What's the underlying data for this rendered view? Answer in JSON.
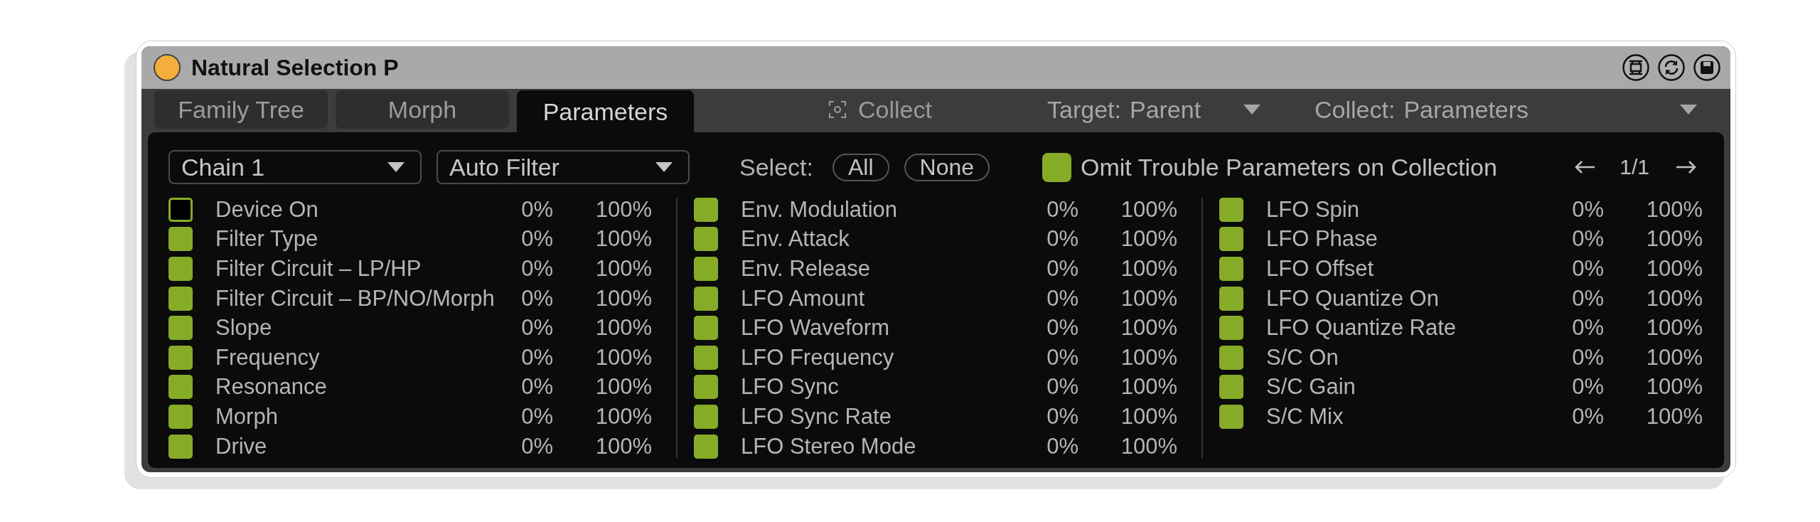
{
  "window": {
    "title": "Natural Selection P",
    "on": true
  },
  "tabs": [
    {
      "label": "Family Tree",
      "selected": false
    },
    {
      "label": "Morph",
      "selected": false
    },
    {
      "label": "Parameters",
      "selected": true
    }
  ],
  "collect_button": {
    "label": "Collect"
  },
  "target_menu": {
    "label": "Target:",
    "value": "Parent"
  },
  "collect_menu": {
    "label": "Collect:",
    "value": "Parameters"
  },
  "chain_menu": {
    "value": "Chain 1"
  },
  "device_menu": {
    "value": "Auto Filter"
  },
  "select": {
    "label": "Select:",
    "buttons": [
      "All",
      "None"
    ]
  },
  "omit_trouble": {
    "label": "Omit Trouble Parameters on Collection",
    "checked": true
  },
  "pager": {
    "page": "1/1"
  },
  "parameter_columns": [
    {
      "parameters": [
        {
          "name": "Device On",
          "checked": false,
          "min": "0%",
          "max": "100%"
        },
        {
          "name": "Filter Type",
          "checked": true,
          "min": "0%",
          "max": "100%"
        },
        {
          "name": "Filter Circuit – LP/HP",
          "checked": true,
          "min": "0%",
          "max": "100%"
        },
        {
          "name": "Filter Circuit – BP/NO/Morph",
          "checked": true,
          "min": "0%",
          "max": "100%"
        },
        {
          "name": "Slope",
          "checked": true,
          "min": "0%",
          "max": "100%"
        },
        {
          "name": "Frequency",
          "checked": true,
          "min": "0%",
          "max": "100%"
        },
        {
          "name": "Resonance",
          "checked": true,
          "min": "0%",
          "max": "100%"
        },
        {
          "name": "Morph",
          "checked": true,
          "min": "0%",
          "max": "100%"
        },
        {
          "name": "Drive",
          "checked": true,
          "min": "0%",
          "max": "100%"
        }
      ]
    },
    {
      "parameters": [
        {
          "name": "Env. Modulation",
          "checked": true,
          "min": "0%",
          "max": "100%"
        },
        {
          "name": "Env. Attack",
          "checked": true,
          "min": "0%",
          "max": "100%"
        },
        {
          "name": "Env. Release",
          "checked": true,
          "min": "0%",
          "max": "100%"
        },
        {
          "name": "LFO Amount",
          "checked": true,
          "min": "0%",
          "max": "100%"
        },
        {
          "name": "LFO Waveform",
          "checked": true,
          "min": "0%",
          "max": "100%"
        },
        {
          "name": "LFO Frequency",
          "checked": true,
          "min": "0%",
          "max": "100%"
        },
        {
          "name": "LFO Sync",
          "checked": true,
          "min": "0%",
          "max": "100%"
        },
        {
          "name": "LFO Sync Rate",
          "checked": true,
          "min": "0%",
          "max": "100%"
        },
        {
          "name": "LFO Stereo Mode",
          "checked": true,
          "min": "0%",
          "max": "100%"
        }
      ]
    },
    {
      "parameters": [
        {
          "name": "LFO Spin",
          "checked": true,
          "min": "0%",
          "max": "100%"
        },
        {
          "name": "LFO Phase",
          "checked": true,
          "min": "0%",
          "max": "100%"
        },
        {
          "name": "LFO Offset",
          "checked": true,
          "min": "0%",
          "max": "100%"
        },
        {
          "name": "LFO Quantize On",
          "checked": true,
          "min": "0%",
          "max": "100%"
        },
        {
          "name": "LFO Quantize Rate",
          "checked": true,
          "min": "0%",
          "max": "100%"
        },
        {
          "name": "S/C On",
          "checked": true,
          "min": "0%",
          "max": "100%"
        },
        {
          "name": "S/C Gain",
          "checked": true,
          "min": "0%",
          "max": "100%"
        },
        {
          "name": "S/C Mix",
          "checked": true,
          "min": "0%",
          "max": "100%"
        }
      ]
    }
  ]
}
